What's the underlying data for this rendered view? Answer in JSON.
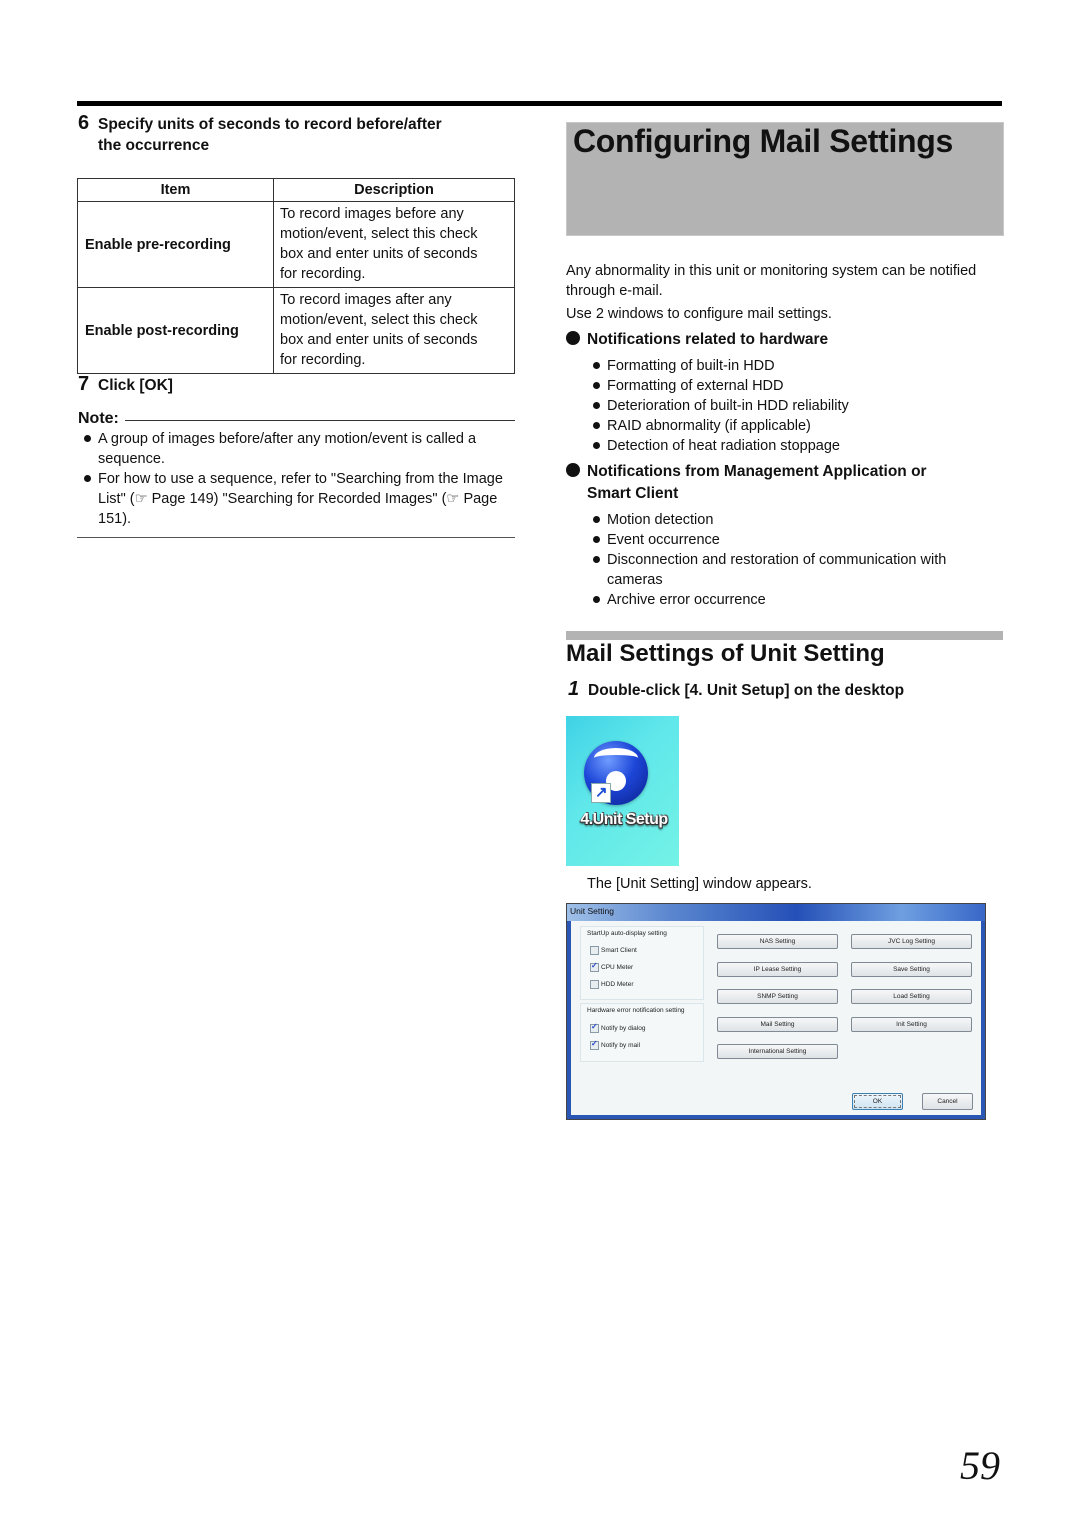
{
  "left": {
    "step6": {
      "number": "6",
      "line1": "Specify units of seconds to record before/after",
      "line2": "the occurrence"
    },
    "table": {
      "headers": [
        "Item",
        "Description"
      ],
      "rows": [
        {
          "item": "Enable pre-recording",
          "description": [
            "To record images before any",
            "motion/event, select this check",
            "box and enter units of seconds",
            "for recording."
          ]
        },
        {
          "item": "Enable post-recording",
          "description": [
            "To record images after any",
            "motion/event, select this check",
            "box and enter units of seconds",
            "for recording."
          ]
        }
      ]
    },
    "step7": {
      "number": "7",
      "text": "Click [OK]"
    },
    "note": {
      "heading": "Note:",
      "items": [
        "A group of images before/after any motion/event is called a sequence.",
        "For how to use a sequence, refer to \"Searching from the Image List\" (☞ Page 149) \"Searching for Recorded Images\" (☞ Page 151)."
      ]
    }
  },
  "right": {
    "title": "Configuring Mail Settings",
    "intro": "Any abnormality in this unit or monitoring system can be notified through e-mail.",
    "intro2": "Use 2 windows to configure mail settings.",
    "hardware": {
      "heading": "Notifications related to hardware",
      "items": [
        "Formatting of built-in HDD",
        "Formatting of external HDD",
        "Deterioration of built-in HDD reliability",
        "RAID abnormality (if applicable)",
        "Detection of heat radiation stoppage"
      ]
    },
    "management": {
      "heading_line1": "Notifications from Management Application or",
      "heading_line2": "Smart Client",
      "items": [
        "Motion detection",
        "Event occurrence",
        "Disconnection and restoration of communication with cameras",
        "Archive error occurrence"
      ]
    },
    "section_title": "Mail Settings of Unit Setting",
    "step1": {
      "number": "1",
      "text": "Double-click [4. Unit Setup] on the desktop"
    },
    "desktop_icon": {
      "label": "4.Unit Setup",
      "icon": "unit-setup-disc-icon"
    },
    "window_appears": "The [Unit Setting] window appears.",
    "window": {
      "title": "Unit Setting",
      "startup_group": {
        "label": "StartUp auto-display setting",
        "checkboxes": [
          {
            "label": "Smart Client",
            "checked": false
          },
          {
            "label": "CPU Meter",
            "checked": true
          },
          {
            "label": "HDD Meter",
            "checked": false
          }
        ]
      },
      "hardware_group": {
        "label": "Hardware error notification setting",
        "checkboxes": [
          {
            "label": "Notify by dialog",
            "checked": true
          },
          {
            "label": "Notify by mail",
            "checked": true
          }
        ]
      },
      "buttons": [
        "NAS Setting",
        "JVC Log Setting",
        "IP Lease Setting",
        "Save Setting",
        "SNMP Setting",
        "Load Setting",
        "Mail Setting",
        "Init Setting",
        "International Setting"
      ],
      "ok_label": "OK",
      "cancel_label": "Cancel"
    }
  },
  "page_number": "59"
}
